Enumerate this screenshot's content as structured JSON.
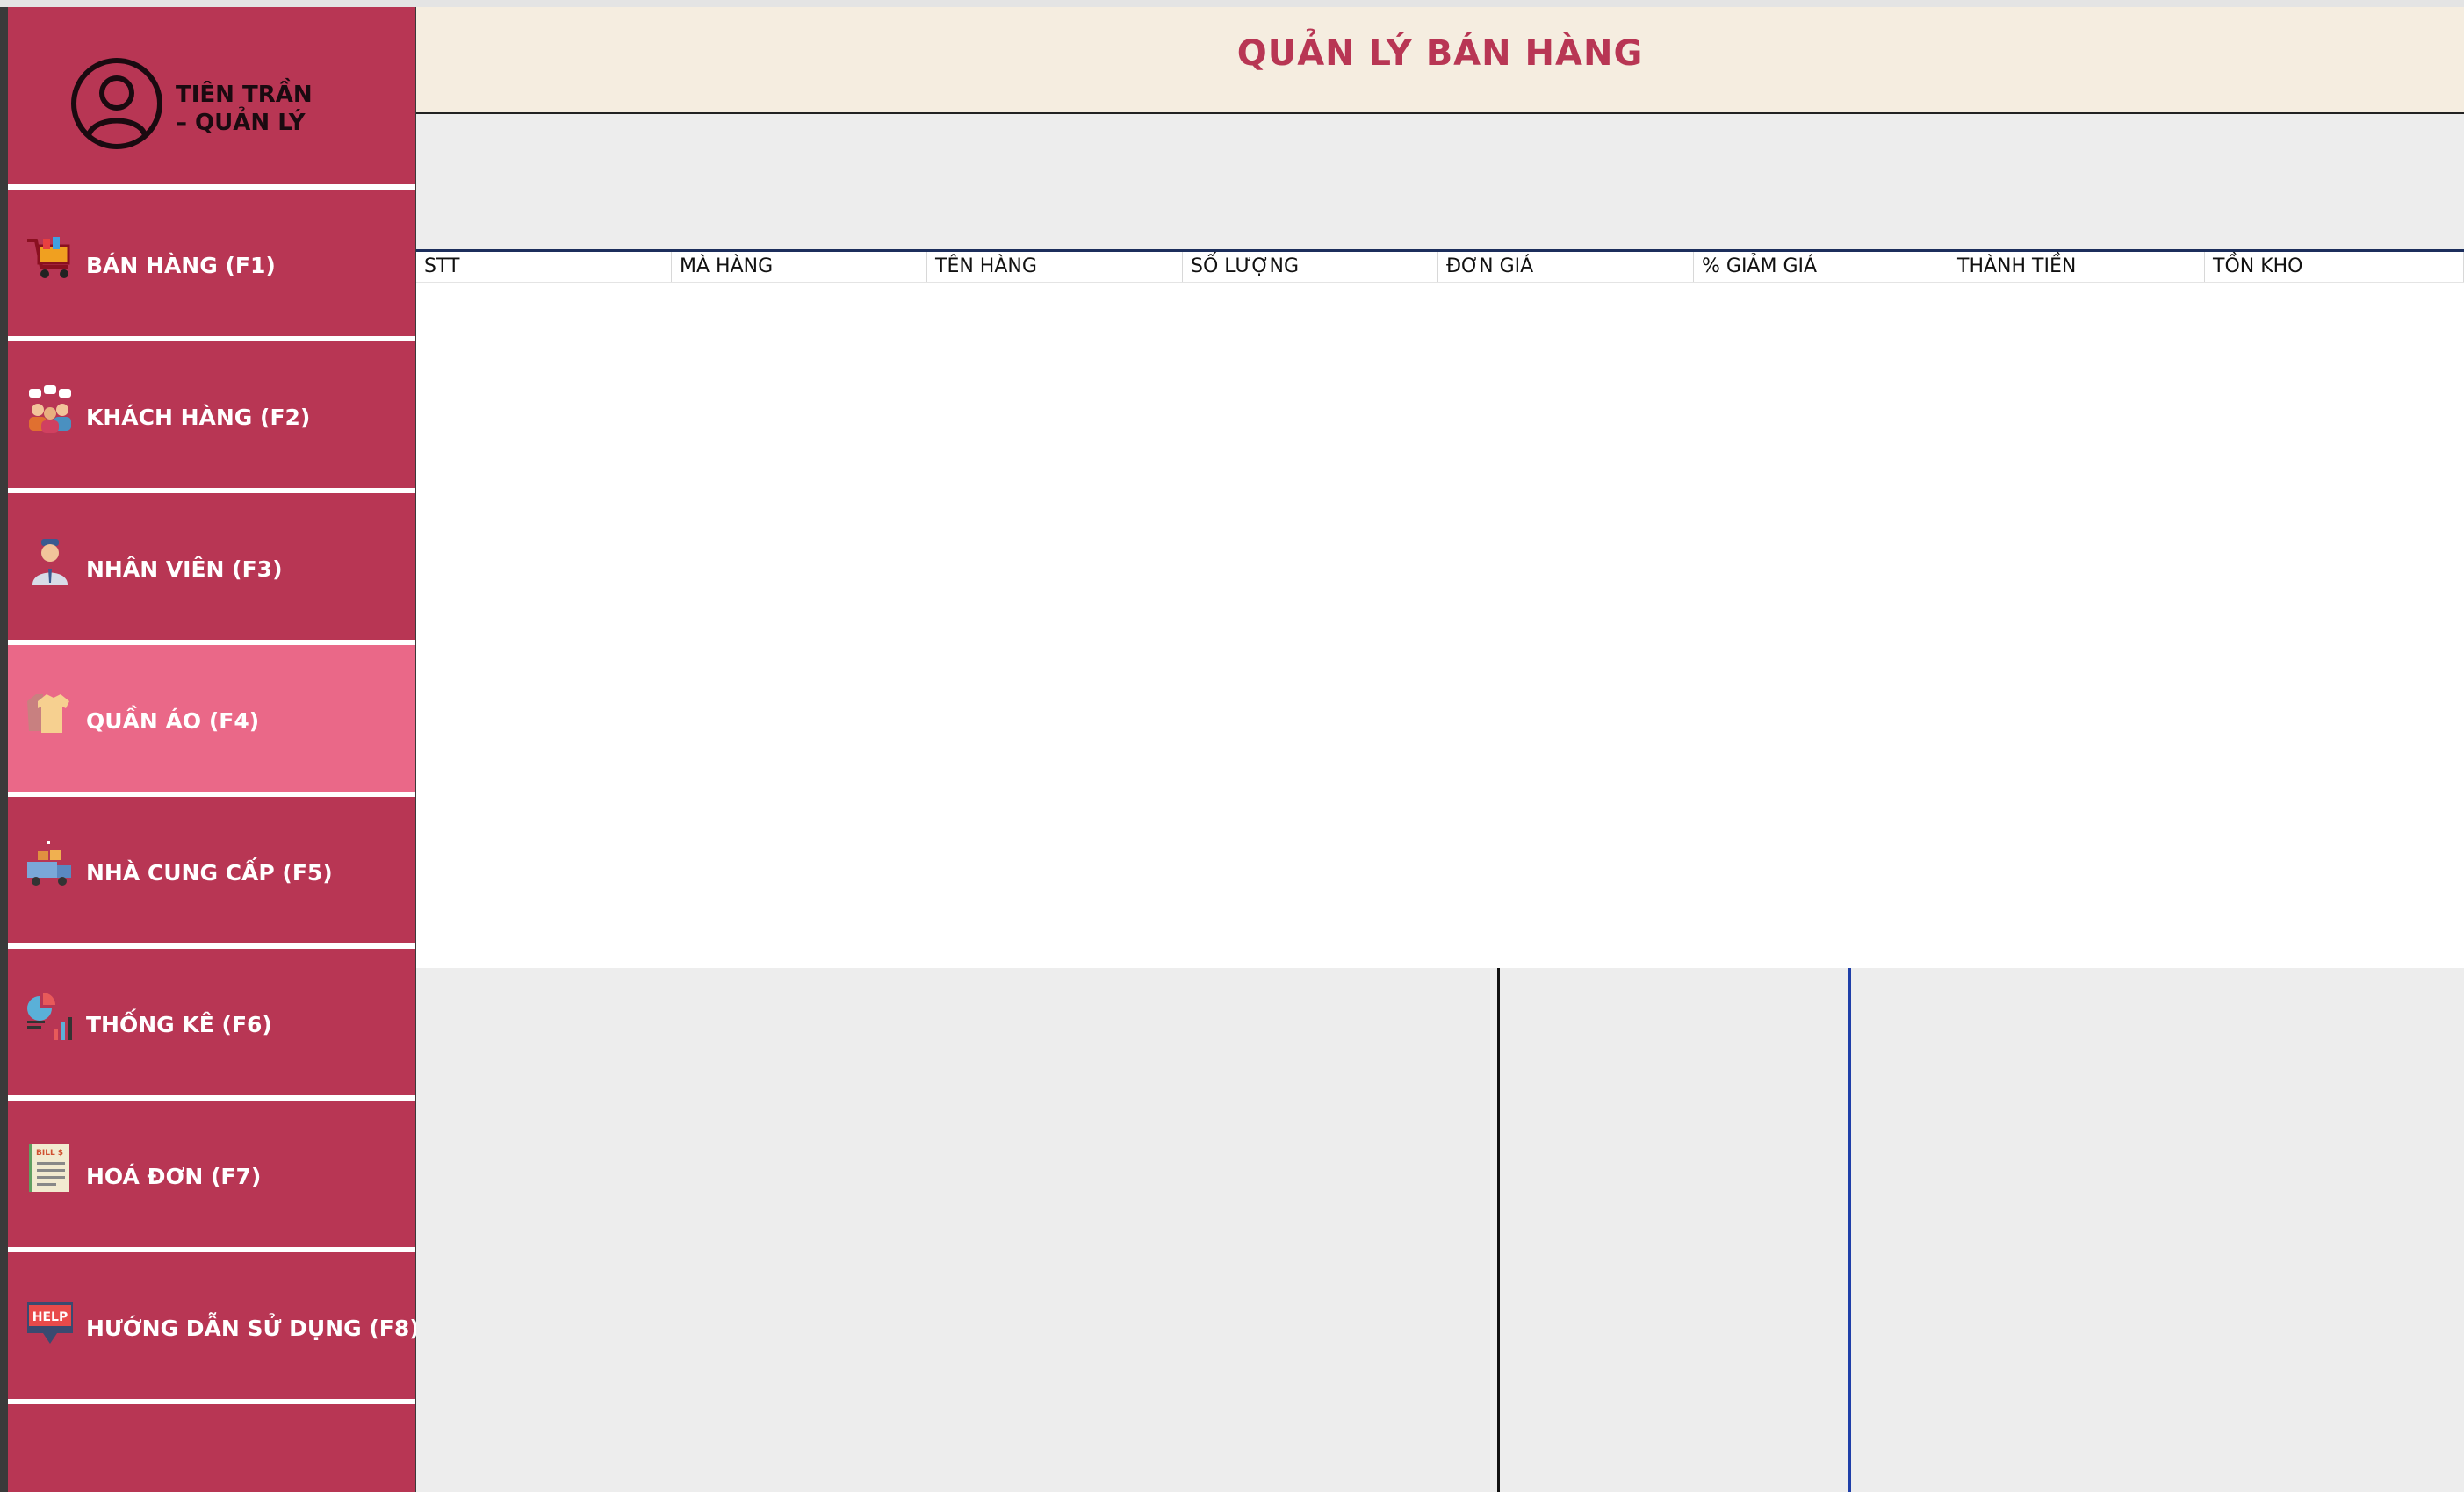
{
  "app": {
    "title": "QUẢN LÝ BÁN HÀNG"
  },
  "user": {
    "name_line1": "TIÊN TRẦN",
    "name_line2": "– QUẢN LÝ",
    "icon": "user-circle-icon"
  },
  "sidebar": {
    "items": [
      {
        "label": "BÁN HÀNG (F1)",
        "icon": "shopping-cart-icon",
        "active": false
      },
      {
        "label": "KHÁCH HÀNG (F2)",
        "icon": "customers-icon",
        "active": false
      },
      {
        "label": "NHÂN VIÊN (F3)",
        "icon": "employee-icon",
        "active": false
      },
      {
        "label": "QUẦN ÁO (F4)",
        "icon": "clothes-icon",
        "active": true
      },
      {
        "label": "NHÀ CUNG CẤP (F5)",
        "icon": "supplier-truck-icon",
        "active": false
      },
      {
        "label": "THỐNG KÊ (F6)",
        "icon": "statistics-chart-icon",
        "active": false
      },
      {
        "label": "HOÁ ĐƠN (F7)",
        "icon": "bill-invoice-icon",
        "active": false
      },
      {
        "label": "HƯỚNG DẪN SỬ DỤNG (F8)",
        "icon": "help-icon",
        "active": false
      }
    ],
    "help_icon_text": "HELP",
    "bill_icon_text": "BILL $"
  },
  "table": {
    "columns": [
      "STT",
      "MÀ HÀNG",
      "TÊN HÀNG",
      "SỐ LƯỢNG",
      "ĐƠN GIÁ",
      "% GIẢM GIÁ",
      "THÀNH TIỀN",
      "TỒN KHO"
    ],
    "rows": []
  },
  "colors": {
    "sidebar": "#b83654",
    "sidebar_active": "#ea6888",
    "header_bg": "#f5ede0",
    "title": "#b83654"
  }
}
